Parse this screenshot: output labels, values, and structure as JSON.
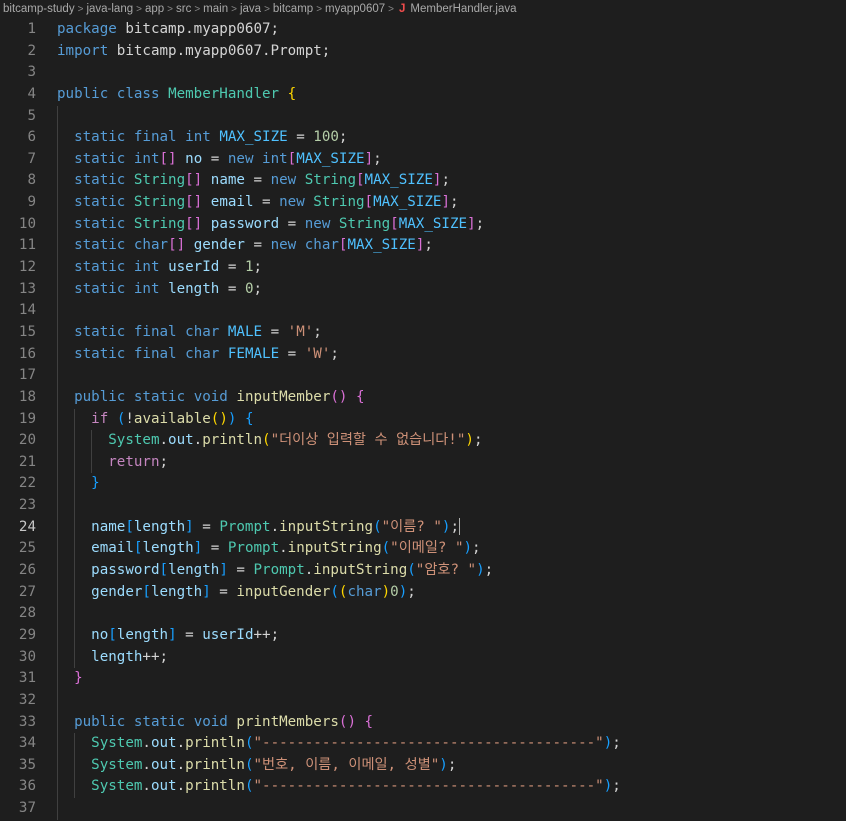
{
  "breadcrumb": {
    "segments": [
      "bitcamp-study",
      "java-lang",
      "app",
      "src",
      "main",
      "java",
      "bitcamp",
      "myapp0607"
    ],
    "file_icon": "J",
    "file_name": "MemberHandler.java"
  },
  "editor": {
    "lines": [
      {
        "n": "1",
        "c": [
          [
            "kw",
            "package"
          ],
          [
            "p",
            " bitcamp.myapp0607;"
          ]
        ]
      },
      {
        "n": "2",
        "c": [
          [
            "kw",
            "import"
          ],
          [
            "p",
            " bitcamp.myapp0607.Prompt;"
          ]
        ]
      },
      {
        "n": "3",
        "c": []
      },
      {
        "n": "4",
        "c": [
          [
            "kw",
            "public"
          ],
          [
            "p",
            " "
          ],
          [
            "kw",
            "class"
          ],
          [
            "p",
            " "
          ],
          [
            "ty",
            "MemberHandler"
          ],
          [
            "p",
            " "
          ],
          [
            "br1",
            "{"
          ]
        ]
      },
      {
        "n": "5",
        "c": []
      },
      {
        "n": "6",
        "c": [
          [
            "p",
            "  "
          ],
          [
            "kw",
            "static"
          ],
          [
            "p",
            " "
          ],
          [
            "kw",
            "final"
          ],
          [
            "p",
            " "
          ],
          [
            "kw",
            "int"
          ],
          [
            "p",
            " "
          ],
          [
            "const",
            "MAX_SIZE"
          ],
          [
            "p",
            " = "
          ],
          [
            "num",
            "100"
          ],
          [
            "p",
            ";"
          ]
        ]
      },
      {
        "n": "7",
        "c": [
          [
            "p",
            "  "
          ],
          [
            "kw",
            "static"
          ],
          [
            "p",
            " "
          ],
          [
            "kw",
            "int"
          ],
          [
            "br2",
            "[]"
          ],
          [
            "p",
            " "
          ],
          [
            "var",
            "no"
          ],
          [
            "p",
            " = "
          ],
          [
            "kw",
            "new"
          ],
          [
            "p",
            " "
          ],
          [
            "kw",
            "int"
          ],
          [
            "br2",
            "["
          ],
          [
            "const",
            "MAX_SIZE"
          ],
          [
            "br2",
            "]"
          ],
          [
            "p",
            ";"
          ]
        ]
      },
      {
        "n": "8",
        "c": [
          [
            "p",
            "  "
          ],
          [
            "kw",
            "static"
          ],
          [
            "p",
            " "
          ],
          [
            "ty",
            "String"
          ],
          [
            "br2",
            "[]"
          ],
          [
            "p",
            " "
          ],
          [
            "var",
            "name"
          ],
          [
            "p",
            " = "
          ],
          [
            "kw",
            "new"
          ],
          [
            "p",
            " "
          ],
          [
            "ty",
            "String"
          ],
          [
            "br2",
            "["
          ],
          [
            "const",
            "MAX_SIZE"
          ],
          [
            "br2",
            "]"
          ],
          [
            "p",
            ";"
          ]
        ]
      },
      {
        "n": "9",
        "c": [
          [
            "p",
            "  "
          ],
          [
            "kw",
            "static"
          ],
          [
            "p",
            " "
          ],
          [
            "ty",
            "String"
          ],
          [
            "br2",
            "[]"
          ],
          [
            "p",
            " "
          ],
          [
            "var",
            "email"
          ],
          [
            "p",
            " = "
          ],
          [
            "kw",
            "new"
          ],
          [
            "p",
            " "
          ],
          [
            "ty",
            "String"
          ],
          [
            "br2",
            "["
          ],
          [
            "const",
            "MAX_SIZE"
          ],
          [
            "br2",
            "]"
          ],
          [
            "p",
            ";"
          ]
        ]
      },
      {
        "n": "10",
        "c": [
          [
            "p",
            "  "
          ],
          [
            "kw",
            "static"
          ],
          [
            "p",
            " "
          ],
          [
            "ty",
            "String"
          ],
          [
            "br2",
            "[]"
          ],
          [
            "p",
            " "
          ],
          [
            "var",
            "password"
          ],
          [
            "p",
            " = "
          ],
          [
            "kw",
            "new"
          ],
          [
            "p",
            " "
          ],
          [
            "ty",
            "String"
          ],
          [
            "br2",
            "["
          ],
          [
            "const",
            "MAX_SIZE"
          ],
          [
            "br2",
            "]"
          ],
          [
            "p",
            ";"
          ]
        ]
      },
      {
        "n": "11",
        "c": [
          [
            "p",
            "  "
          ],
          [
            "kw",
            "static"
          ],
          [
            "p",
            " "
          ],
          [
            "kw",
            "char"
          ],
          [
            "br2",
            "[]"
          ],
          [
            "p",
            " "
          ],
          [
            "var",
            "gender"
          ],
          [
            "p",
            " = "
          ],
          [
            "kw",
            "new"
          ],
          [
            "p",
            " "
          ],
          [
            "kw",
            "char"
          ],
          [
            "br2",
            "["
          ],
          [
            "const",
            "MAX_SIZE"
          ],
          [
            "br2",
            "]"
          ],
          [
            "p",
            ";"
          ]
        ]
      },
      {
        "n": "12",
        "c": [
          [
            "p",
            "  "
          ],
          [
            "kw",
            "static"
          ],
          [
            "p",
            " "
          ],
          [
            "kw",
            "int"
          ],
          [
            "p",
            " "
          ],
          [
            "var",
            "userId"
          ],
          [
            "p",
            " = "
          ],
          [
            "num",
            "1"
          ],
          [
            "p",
            ";"
          ]
        ]
      },
      {
        "n": "13",
        "c": [
          [
            "p",
            "  "
          ],
          [
            "kw",
            "static"
          ],
          [
            "p",
            " "
          ],
          [
            "kw",
            "int"
          ],
          [
            "p",
            " "
          ],
          [
            "var",
            "length"
          ],
          [
            "p",
            " = "
          ],
          [
            "num",
            "0"
          ],
          [
            "p",
            ";"
          ]
        ]
      },
      {
        "n": "14",
        "c": []
      },
      {
        "n": "15",
        "c": [
          [
            "p",
            "  "
          ],
          [
            "kw",
            "static"
          ],
          [
            "p",
            " "
          ],
          [
            "kw",
            "final"
          ],
          [
            "p",
            " "
          ],
          [
            "kw",
            "char"
          ],
          [
            "p",
            " "
          ],
          [
            "const",
            "MALE"
          ],
          [
            "p",
            " = "
          ],
          [
            "str",
            "'M'"
          ],
          [
            "p",
            ";"
          ]
        ]
      },
      {
        "n": "16",
        "c": [
          [
            "p",
            "  "
          ],
          [
            "kw",
            "static"
          ],
          [
            "p",
            " "
          ],
          [
            "kw",
            "final"
          ],
          [
            "p",
            " "
          ],
          [
            "kw",
            "char"
          ],
          [
            "p",
            " "
          ],
          [
            "const",
            "FEMALE"
          ],
          [
            "p",
            " = "
          ],
          [
            "str",
            "'W'"
          ],
          [
            "p",
            ";"
          ]
        ]
      },
      {
        "n": "17",
        "c": []
      },
      {
        "n": "18",
        "c": [
          [
            "p",
            "  "
          ],
          [
            "kw",
            "public"
          ],
          [
            "p",
            " "
          ],
          [
            "kw",
            "static"
          ],
          [
            "p",
            " "
          ],
          [
            "kw",
            "void"
          ],
          [
            "p",
            " "
          ],
          [
            "fn",
            "inputMember"
          ],
          [
            "br2",
            "()"
          ],
          [
            "p",
            " "
          ],
          [
            "br2",
            "{"
          ]
        ]
      },
      {
        "n": "19",
        "c": [
          [
            "p",
            "    "
          ],
          [
            "ctl",
            "if"
          ],
          [
            "p",
            " "
          ],
          [
            "br3",
            "("
          ],
          [
            "p",
            "!"
          ],
          [
            "fn",
            "available"
          ],
          [
            "br1",
            "()"
          ],
          [
            "br3",
            ")"
          ],
          [
            "p",
            " "
          ],
          [
            "br3",
            "{"
          ]
        ]
      },
      {
        "n": "20",
        "c": [
          [
            "p",
            "      "
          ],
          [
            "ty",
            "System"
          ],
          [
            "p",
            "."
          ],
          [
            "var",
            "out"
          ],
          [
            "p",
            "."
          ],
          [
            "fn",
            "println"
          ],
          [
            "br1",
            "("
          ],
          [
            "str",
            "\"더이상 입력할 수 없습니다!\""
          ],
          [
            "br1",
            ")"
          ],
          [
            "p",
            ";"
          ]
        ]
      },
      {
        "n": "21",
        "c": [
          [
            "p",
            "      "
          ],
          [
            "ctl",
            "return"
          ],
          [
            "p",
            ";"
          ]
        ]
      },
      {
        "n": "22",
        "c": [
          [
            "p",
            "    "
          ],
          [
            "br3",
            "}"
          ]
        ]
      },
      {
        "n": "23",
        "c": []
      },
      {
        "n": "24",
        "c": [
          [
            "p",
            "    "
          ],
          [
            "var",
            "name"
          ],
          [
            "br3",
            "["
          ],
          [
            "var",
            "length"
          ],
          [
            "br3",
            "]"
          ],
          [
            "p",
            " = "
          ],
          [
            "ty",
            "Prompt"
          ],
          [
            "p",
            "."
          ],
          [
            "fn",
            "inputString"
          ],
          [
            "br3",
            "("
          ],
          [
            "str",
            "\"이름? \""
          ],
          [
            "br3",
            ")"
          ],
          [
            "p",
            ";"
          ],
          [
            "cursor",
            ""
          ]
        ]
      },
      {
        "n": "25",
        "c": [
          [
            "p",
            "    "
          ],
          [
            "var",
            "email"
          ],
          [
            "br3",
            "["
          ],
          [
            "var",
            "length"
          ],
          [
            "br3",
            "]"
          ],
          [
            "p",
            " = "
          ],
          [
            "ty",
            "Prompt"
          ],
          [
            "p",
            "."
          ],
          [
            "fn",
            "inputString"
          ],
          [
            "br3",
            "("
          ],
          [
            "str",
            "\"이메일? \""
          ],
          [
            "br3",
            ")"
          ],
          [
            "p",
            ";"
          ]
        ]
      },
      {
        "n": "26",
        "c": [
          [
            "p",
            "    "
          ],
          [
            "var",
            "password"
          ],
          [
            "br3",
            "["
          ],
          [
            "var",
            "length"
          ],
          [
            "br3",
            "]"
          ],
          [
            "p",
            " = "
          ],
          [
            "ty",
            "Prompt"
          ],
          [
            "p",
            "."
          ],
          [
            "fn",
            "inputString"
          ],
          [
            "br3",
            "("
          ],
          [
            "str",
            "\"암호? \""
          ],
          [
            "br3",
            ")"
          ],
          [
            "p",
            ";"
          ]
        ]
      },
      {
        "n": "27",
        "c": [
          [
            "p",
            "    "
          ],
          [
            "var",
            "gender"
          ],
          [
            "br3",
            "["
          ],
          [
            "var",
            "length"
          ],
          [
            "br3",
            "]"
          ],
          [
            "p",
            " = "
          ],
          [
            "fn",
            "inputGender"
          ],
          [
            "br3",
            "("
          ],
          [
            "br1",
            "("
          ],
          [
            "kw",
            "char"
          ],
          [
            "br1",
            ")"
          ],
          [
            "num",
            "0"
          ],
          [
            "br3",
            ")"
          ],
          [
            "p",
            ";"
          ]
        ]
      },
      {
        "n": "28",
        "c": []
      },
      {
        "n": "29",
        "c": [
          [
            "p",
            "    "
          ],
          [
            "var",
            "no"
          ],
          [
            "br3",
            "["
          ],
          [
            "var",
            "length"
          ],
          [
            "br3",
            "]"
          ],
          [
            "p",
            " = "
          ],
          [
            "var",
            "userId"
          ],
          [
            "p",
            "++;"
          ]
        ]
      },
      {
        "n": "30",
        "c": [
          [
            "p",
            "    "
          ],
          [
            "var",
            "length"
          ],
          [
            "p",
            "++;"
          ]
        ]
      },
      {
        "n": "31",
        "c": [
          [
            "p",
            "  "
          ],
          [
            "br2",
            "}"
          ]
        ]
      },
      {
        "n": "32",
        "c": []
      },
      {
        "n": "33",
        "c": [
          [
            "p",
            "  "
          ],
          [
            "kw",
            "public"
          ],
          [
            "p",
            " "
          ],
          [
            "kw",
            "static"
          ],
          [
            "p",
            " "
          ],
          [
            "kw",
            "void"
          ],
          [
            "p",
            " "
          ],
          [
            "fn",
            "printMembers"
          ],
          [
            "br2",
            "()"
          ],
          [
            "p",
            " "
          ],
          [
            "br2",
            "{"
          ]
        ]
      },
      {
        "n": "34",
        "c": [
          [
            "p",
            "    "
          ],
          [
            "ty",
            "System"
          ],
          [
            "p",
            "."
          ],
          [
            "var",
            "out"
          ],
          [
            "p",
            "."
          ],
          [
            "fn",
            "println"
          ],
          [
            "br3",
            "("
          ],
          [
            "str",
            "\"---------------------------------------\""
          ],
          [
            "br3",
            ")"
          ],
          [
            "p",
            ";"
          ]
        ]
      },
      {
        "n": "35",
        "c": [
          [
            "p",
            "    "
          ],
          [
            "ty",
            "System"
          ],
          [
            "p",
            "."
          ],
          [
            "var",
            "out"
          ],
          [
            "p",
            "."
          ],
          [
            "fn",
            "println"
          ],
          [
            "br3",
            "("
          ],
          [
            "str",
            "\"번호, 이름, 이메일, 성별\""
          ],
          [
            "br3",
            ")"
          ],
          [
            "p",
            ";"
          ]
        ]
      },
      {
        "n": "36",
        "c": [
          [
            "p",
            "    "
          ],
          [
            "ty",
            "System"
          ],
          [
            "p",
            "."
          ],
          [
            "var",
            "out"
          ],
          [
            "p",
            "."
          ],
          [
            "fn",
            "println"
          ],
          [
            "br3",
            "("
          ],
          [
            "str",
            "\"---------------------------------------\""
          ],
          [
            "br3",
            ")"
          ],
          [
            "p",
            ";"
          ]
        ]
      },
      {
        "n": "37",
        "c": []
      }
    ],
    "current_line": "24"
  }
}
